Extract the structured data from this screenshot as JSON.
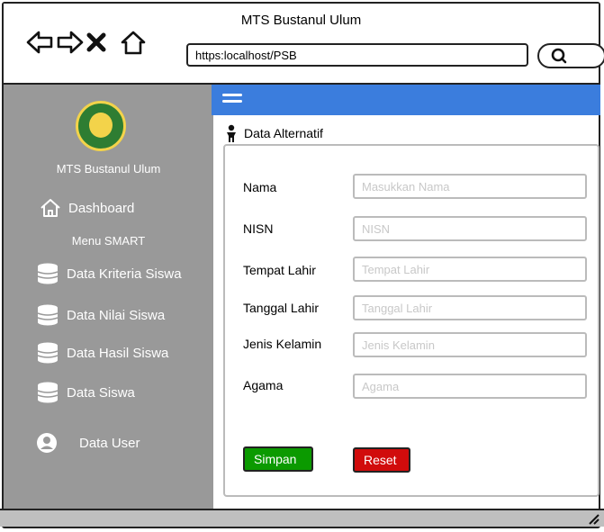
{
  "window": {
    "title": "MTS Bustanul Ulum",
    "url": "https:localhost/PSB",
    "icons": [
      "back-arrow-icon",
      "forward-arrow-icon",
      "close-icon",
      "home-icon",
      "search-icon"
    ]
  },
  "sidebar": {
    "brand": "MTS Bustanul Ulum",
    "dashboard": "Dashboard",
    "menu_label": "Menu SMART",
    "items": [
      {
        "label": "Data Kriteria Siswa",
        "icon": "database-icon"
      },
      {
        "label": "Data Nilai Siswa",
        "icon": "database-icon"
      },
      {
        "label": "Data Hasil Siswa",
        "icon": "database-icon"
      },
      {
        "label": "Data Siswa",
        "icon": "database-icon"
      },
      {
        "label": "Data User",
        "icon": "user-icon"
      }
    ]
  },
  "content": {
    "section_title": "Data Alternatif",
    "form": [
      {
        "label": "Nama",
        "placeholder": "Masukkan Nama"
      },
      {
        "label": "NISN",
        "placeholder": "NISN"
      },
      {
        "label": "Tempat Lahir",
        "placeholder": "Tempat Lahir"
      },
      {
        "label": "Tanggal Lahir",
        "placeholder": "Tanggal Lahir"
      },
      {
        "label": "Jenis Kelamin",
        "placeholder": "Jenis Kelamin"
      },
      {
        "label": "Agama",
        "placeholder": "Agama"
      }
    ],
    "save_label": "Simpan",
    "reset_label": "Reset"
  },
  "colors": {
    "sidebar": "#999999",
    "topbar": "#3b7ddd",
    "save": "#0b9a00",
    "reset": "#d10c0c"
  }
}
